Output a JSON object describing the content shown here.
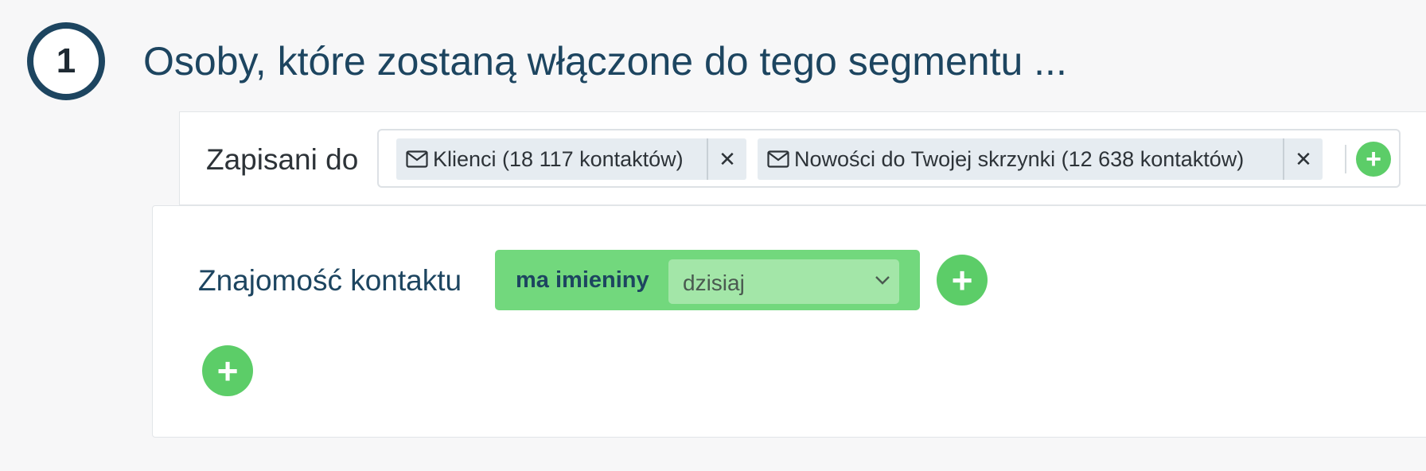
{
  "step": {
    "number": "1",
    "title": "Osoby, które zostaną włączone do tego segmentu ..."
  },
  "subscribed": {
    "label": "Zapisani do",
    "tags": [
      {
        "icon": "envelope-icon",
        "label": "Klienci (18 117 kontaktów)",
        "remove": "✕"
      },
      {
        "icon": "envelope-icon",
        "label": "Nowości do Twojej skrzynki (12 638 kontaktów)",
        "remove": "✕"
      }
    ],
    "add_icon": "plus-icon"
  },
  "filter": {
    "label": "Znajomość kontaktu",
    "condition": {
      "name": "ma imieniny",
      "selected_value": "dzisiaj"
    },
    "add_condition_icon": "plus-icon",
    "add_group_icon": "plus-icon"
  },
  "colors": {
    "accent_green": "#5ccd68",
    "condition_green": "#72d87d",
    "title_blue": "#1d4560"
  }
}
